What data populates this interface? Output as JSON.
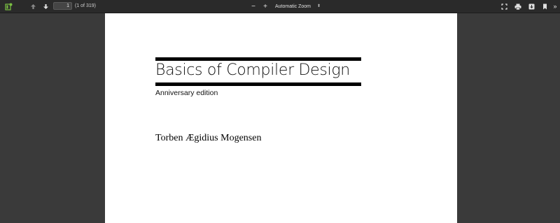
{
  "toolbar": {
    "sidebar_toggle_icon": "sidebar-toggle-icon",
    "prev_icon": "arrow-up-icon",
    "next_icon": "arrow-down-icon",
    "page_number": "1",
    "page_count": "(1 of 319)",
    "zoom_out_label": "−",
    "zoom_in_label": "+",
    "zoom_value": "Automatic Zoom",
    "right_icons": [
      "presentation-mode-icon",
      "print-icon",
      "download-icon",
      "bookmark-icon"
    ],
    "more_label": "»"
  },
  "document": {
    "title": "Basics of Compiler Design",
    "edition": "Anniversary edition",
    "author": "Torben Ægidius Mogensen"
  },
  "colors": {
    "toolbar_bg": "#2a2a2a",
    "viewer_bg": "#3a3a3a",
    "page_bg": "#ffffff",
    "accent_green": "#7bc043"
  }
}
